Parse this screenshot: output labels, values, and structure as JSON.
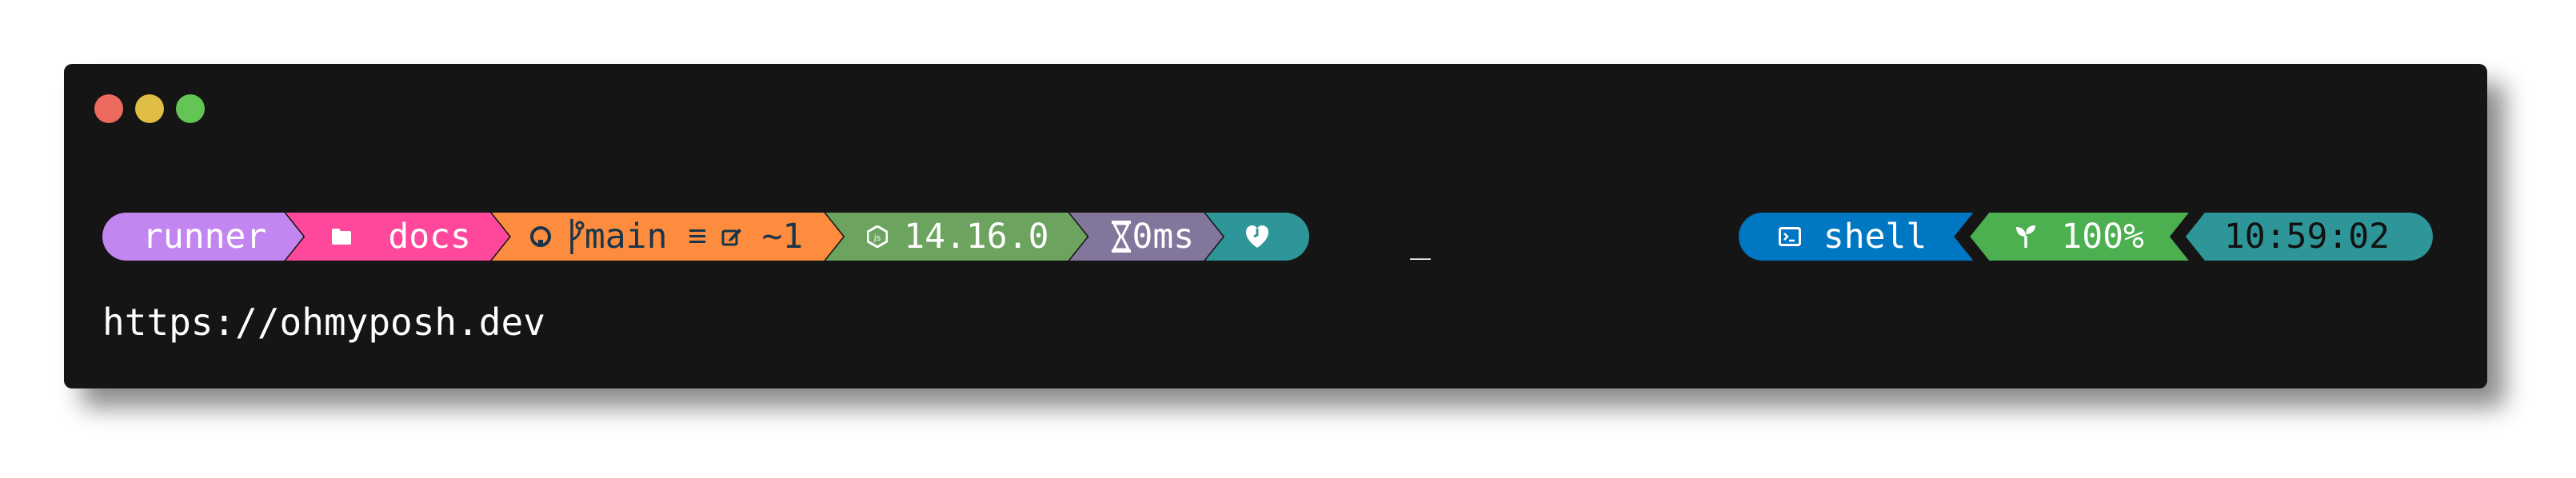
{
  "window": {
    "controls": [
      {
        "name": "close",
        "color": "#ed6a5e"
      },
      {
        "name": "minimize",
        "color": "#e0bd45"
      },
      {
        "name": "maximize",
        "color": "#62c554"
      }
    ]
  },
  "prompt": {
    "session": {
      "text": "runner",
      "bg": "#c386f1",
      "fg": "#ffffff"
    },
    "path": {
      "icon": "folder-icon",
      "text": "docs",
      "bg": "#ff479c",
      "fg": "#ffffff"
    },
    "git": {
      "icon": "github-icon",
      "branch_icon": "branch-icon",
      "branch": "main",
      "status_icon": "stash-icon",
      "edit_icon": "edit-icon",
      "changes": "~1",
      "bg": "#fd8c3f",
      "fg": "#193549"
    },
    "node": {
      "icon": "nodejs-icon",
      "text": "14.16.0",
      "bg": "#6ca35e",
      "fg": "#ffffff"
    },
    "exec_time": {
      "icon": "hourglass-icon",
      "text": "0ms",
      "bg": "#83769c",
      "fg": "#ffffff"
    },
    "status": {
      "icon": "heart-icon",
      "bg": "#2e9599",
      "fg": "#ffffff"
    },
    "cursor": "_",
    "shell": {
      "icon": "terminal-icon",
      "text": "shell",
      "bg": "#0077c2",
      "fg": "#ffffff"
    },
    "battery": {
      "icon": "sprout-icon",
      "text": "100%",
      "bg": "#4caf50",
      "fg": "#ffffff"
    },
    "time": {
      "text": "10:59:02",
      "bg": "#2e9599",
      "fg": "#111111"
    }
  },
  "url": "https://ohmyposh.dev"
}
